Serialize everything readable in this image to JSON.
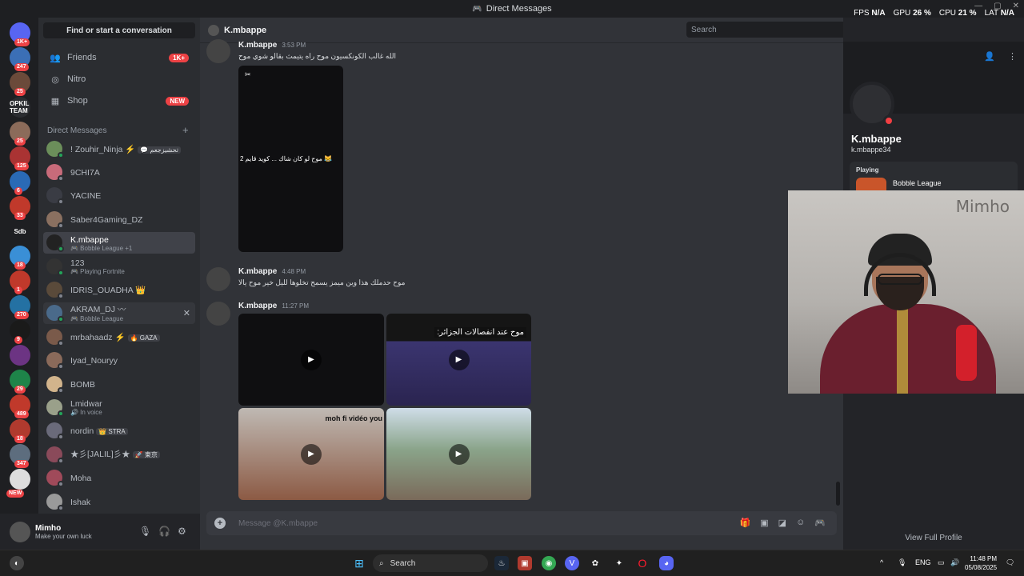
{
  "window": {
    "title": "Direct Messages"
  },
  "overlay": {
    "fps_label": "FPS",
    "fps": "N/A",
    "gpu_label": "GPU",
    "gpu": "26 %",
    "cpu_label": "CPU",
    "cpu": "21 %",
    "lat_label": "LAT",
    "lat": "N/A"
  },
  "rail": {
    "servers": [
      {
        "text": "",
        "badge": "1K+",
        "color": "#5865f2"
      },
      {
        "text": "",
        "badge": "247",
        "color": "#3b6fb6"
      },
      {
        "text": "",
        "badge": "25",
        "color": "#6b4a3a"
      },
      {
        "text": "OPKIL TEAM",
        "badge": "",
        "color": "#2b2d31"
      },
      {
        "text": "",
        "badge": "25",
        "color": "#8b6b5a"
      },
      {
        "text": "",
        "badge": "125",
        "color": "#a33"
      },
      {
        "text": "",
        "badge": "6",
        "color": "#2a6ab5"
      },
      {
        "text": "",
        "badge": "33",
        "color": "#c0392b"
      },
      {
        "text": "Sdb",
        "badge": "",
        "color": "#1e1f22"
      },
      {
        "text": "",
        "badge": "18",
        "color": "#3a8fd6"
      },
      {
        "text": "",
        "badge": "1",
        "color": "#c0392b"
      },
      {
        "text": "",
        "badge": "270",
        "color": "#2471a3"
      },
      {
        "text": "",
        "badge": "9",
        "color": "#1a1a1a"
      },
      {
        "text": "",
        "badge": "",
        "color": "#6c3483"
      },
      {
        "text": "",
        "badge": "29",
        "color": "#1e8449"
      },
      {
        "text": "",
        "badge": "489",
        "color": "#c0392b"
      },
      {
        "text": "",
        "badge": "18",
        "color": "#b03a2e"
      },
      {
        "text": "",
        "badge": "347",
        "color": "#5d6d7e"
      },
      {
        "text": "",
        "badge": "NEW",
        "color": "#dddddd"
      }
    ]
  },
  "sidebar": {
    "find": "Find or start a conversation",
    "nav": [
      {
        "label": "Friends",
        "icon": "👥",
        "badge": "1K+"
      },
      {
        "label": "Nitro",
        "icon": "◎",
        "badge": ""
      },
      {
        "label": "Shop",
        "icon": "▦",
        "badge": "NEW"
      }
    ],
    "dm_header": "Direct Messages",
    "dm_add": "+",
    "dms": [
      {
        "name": "! Zouhir_Ninja ⚡",
        "tag": "💬 تحشيزجعم",
        "sub": "",
        "online": true
      },
      {
        "name": "9CHI7A",
        "tag": "",
        "sub": "",
        "online": false
      },
      {
        "name": "YACINE",
        "tag": "",
        "sub": "",
        "online": false
      },
      {
        "name": "Saber4Gaming_DZ",
        "tag": "",
        "sub": "",
        "online": false
      },
      {
        "name": "K.mbappe",
        "tag": "",
        "sub": "🎮 Bobble League +1",
        "online": true
      },
      {
        "name": "123",
        "tag": "",
        "sub": "🎮 Playing Fortnite",
        "online": true
      },
      {
        "name": "IDRIS_OUADHA 👑",
        "tag": "",
        "sub": "",
        "online": false
      },
      {
        "name": "AKRAM_DJ 〰",
        "tag": "",
        "sub": "🎮 Bobble League",
        "online": true
      },
      {
        "name": "mrbahaadz ⚡",
        "tag": "🔥 GAZA",
        "sub": "",
        "online": false
      },
      {
        "name": "Iyad_Nouryy",
        "tag": "",
        "sub": "",
        "online": false
      },
      {
        "name": "BOMB",
        "tag": "",
        "sub": "",
        "online": false
      },
      {
        "name": "Lmidwar",
        "tag": "",
        "sub": "🔊 In voice",
        "online": true
      },
      {
        "name": "nordin",
        "tag": "👑 STRA",
        "sub": "",
        "online": false
      },
      {
        "name": "★彡[JALIL]彡★",
        "tag": "🚀 東京",
        "sub": "",
        "online": false
      },
      {
        "name": "Moha",
        "tag": "",
        "sub": "",
        "online": false
      },
      {
        "name": "Ishak",
        "tag": "",
        "sub": "",
        "online": false
      }
    ]
  },
  "user": {
    "name": "Mimho",
    "status": "Make your own luck"
  },
  "channel": {
    "name": "K.mbappe"
  },
  "search": {
    "placeholder": "Search"
  },
  "messages": [
    {
      "author": "K.mbappe",
      "time": "3:53 PM",
      "text": "الله غالب الكونكسيون موح راه يتيمث بقالو شوي موح"
    },
    {
      "author": "K.mbappe",
      "time": "4:48 PM",
      "text": "موح حدملك هذا وين ميمز يسمح تخلوها لليل خير موح يالا"
    },
    {
      "author": "K.mbappe",
      "time": "11:27 PM",
      "text": ""
    }
  ],
  "media": {
    "video1_caption": "موح لو كان شاك ... كويد قايم 2 😹",
    "video3_caption": "موح عند انفصالات الجزائر:",
    "video4_caption": "moh fi vidéo you"
  },
  "composer": {
    "placeholder": "Message @K.mbappe"
  },
  "profile": {
    "name": "K.mbappe",
    "username": "k.mbappe34",
    "playing_label": "Playing",
    "game": "Bobble League",
    "full_profile": "View Full Profile"
  },
  "webcam": {
    "watermark": "Mimho"
  },
  "taskbar": {
    "search": "Search",
    "lang": "ENG",
    "time": "11:48 PM",
    "date": "05/08/2025"
  }
}
